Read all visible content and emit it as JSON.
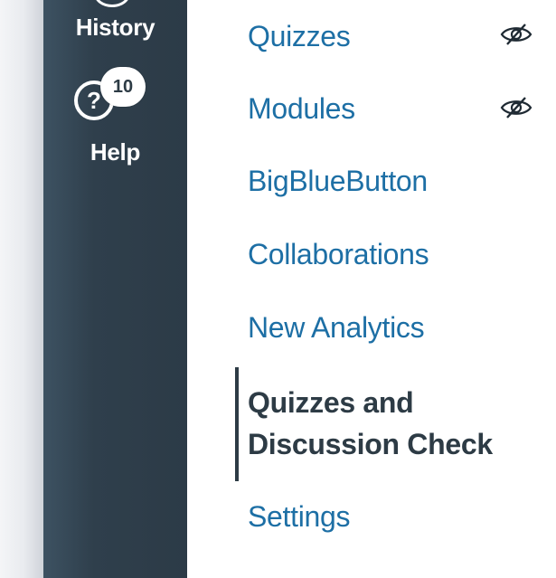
{
  "global_nav": {
    "history_label": "History",
    "help_label": "Help",
    "help_badge_count": "10"
  },
  "course_nav": {
    "items": [
      {
        "label": "Quizzes",
        "hidden_icon": "eye-slash-icon"
      },
      {
        "label": "Modules",
        "hidden_icon": "eye-slash-icon"
      },
      {
        "label": "BigBlueButton"
      },
      {
        "label": "Collaborations"
      },
      {
        "label": "New Analytics"
      },
      {
        "label": "Quizzes and Discussion Check",
        "active": true
      },
      {
        "label": "Settings"
      }
    ]
  },
  "colors": {
    "nav_bg": "#2d3b45",
    "link": "#1d6fa5",
    "active_text": "#2d3b45"
  }
}
